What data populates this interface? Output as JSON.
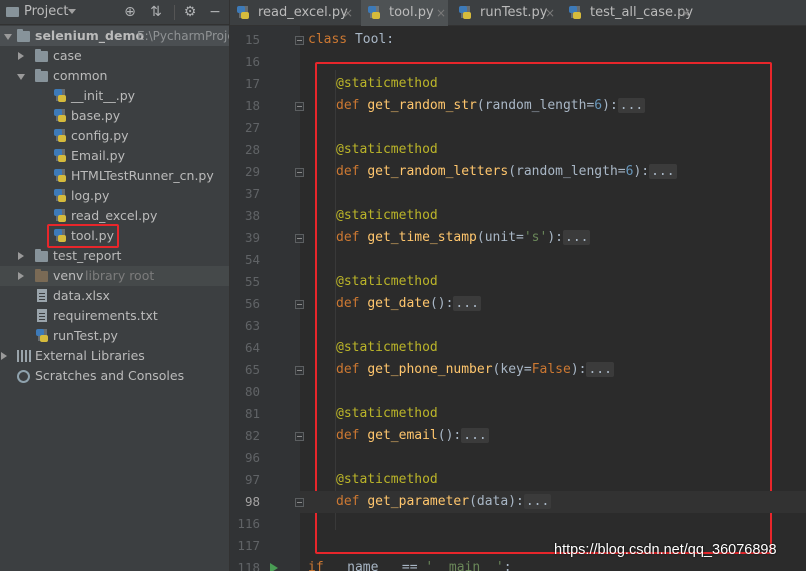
{
  "colors": {
    "panel_bg": "#3c3f41",
    "editor_bg": "#2b2b2b",
    "gutter_bg": "#313335",
    "keyword": "#cc7832",
    "decorator": "#bbb529",
    "function": "#ffc66d",
    "number": "#6897bb",
    "string": "#6a8759",
    "highlight_box": "#e8262b"
  },
  "project_panel": {
    "title": "Project",
    "header_icons": [
      "target-icon",
      "collapse-all-icon",
      "gear-icon",
      "hide-icon"
    ],
    "root": {
      "name": "selenium_demo",
      "path": "E:\\PycharmProje"
    },
    "items": [
      {
        "label": "case",
        "type": "folder"
      },
      {
        "label": "common",
        "type": "folder"
      },
      {
        "label": "__init__.py",
        "type": "python"
      },
      {
        "label": "base.py",
        "type": "python"
      },
      {
        "label": "config.py",
        "type": "python"
      },
      {
        "label": "Email.py",
        "type": "python"
      },
      {
        "label": "HTMLTestRunner_cn.py",
        "type": "python"
      },
      {
        "label": "log.py",
        "type": "python"
      },
      {
        "label": "read_excel.py",
        "type": "python"
      },
      {
        "label": "tool.py",
        "type": "python"
      },
      {
        "label": "test_report",
        "type": "folder"
      },
      {
        "label": "venv",
        "type": "folder",
        "sub": "library root"
      },
      {
        "label": "data.xlsx",
        "type": "file"
      },
      {
        "label": "requirements.txt",
        "type": "file"
      },
      {
        "label": "runTest.py",
        "type": "python"
      },
      {
        "label": "External Libraries",
        "type": "libraries"
      },
      {
        "label": "Scratches and Consoles",
        "type": "scratches"
      }
    ]
  },
  "tabs": [
    {
      "label": "read_excel.py",
      "active": false
    },
    {
      "label": "tool.py",
      "active": true
    },
    {
      "label": "runTest.py",
      "active": false
    },
    {
      "label": "test_all_case.py",
      "active": false
    }
  ],
  "tab_close": "×",
  "editor": {
    "line_numbers": [
      "15",
      "16",
      "17",
      "18",
      "27",
      "28",
      "29",
      "37",
      "38",
      "39",
      "54",
      "55",
      "56",
      "63",
      "64",
      "65",
      "80",
      "81",
      "82",
      "96",
      "97",
      "98",
      "116",
      "117",
      "118"
    ],
    "current_line": "98",
    "class_kw": "class",
    "class_name": " Tool:",
    "decorator": "@staticmethod",
    "def_kw": "def",
    "placeholder": "...",
    "methods": [
      {
        "name": "get_random_str",
        "open": "(random_length=",
        "default": "6",
        "close": "):"
      },
      {
        "name": "get_random_letters",
        "open": "(random_length=",
        "default": "6",
        "close": "):"
      },
      {
        "name": "get_time_stamp",
        "open": "(unit=",
        "default": "'s'",
        "close": "):"
      },
      {
        "name": "get_date",
        "open": "():",
        "default": "",
        "close": ""
      },
      {
        "name": "get_phone_number",
        "open": "(key=",
        "default": "False",
        "close": "):"
      },
      {
        "name": "get_email",
        "open": "():",
        "default": "",
        "close": ""
      },
      {
        "name": "get_parameter",
        "open": "(data):",
        "default": "",
        "close": ""
      }
    ],
    "last_line": "if __name__ == '__main__':"
  },
  "watermark": "https://blog.csdn.net/qq_36076898"
}
